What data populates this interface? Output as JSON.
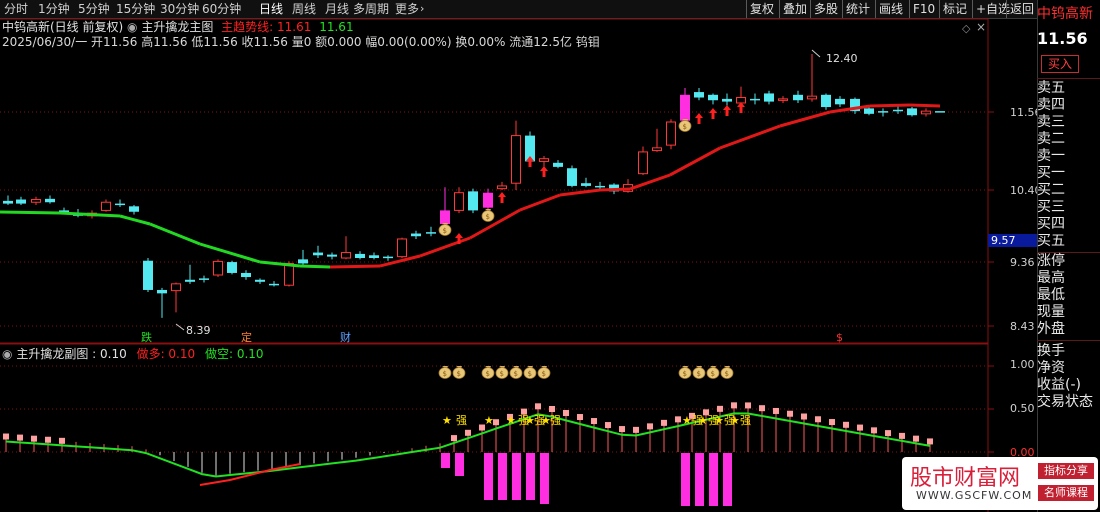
{
  "toolbar": {
    "periods": [
      "分时",
      "1分钟",
      "5分钟",
      "15分钟",
      "30分钟",
      "60分钟",
      "日线",
      "周线",
      "月线",
      "多周期",
      "更多"
    ],
    "active_period": "日线",
    "buttons": [
      "复权",
      "叠加",
      "多股",
      "统计",
      "画线",
      "F10",
      "标记",
      "+自选",
      "返回"
    ]
  },
  "header": {
    "stock_title": "中钨高新(日线 前复权)",
    "indicator_name": "主升擒龙主图",
    "line_label": "主趋势线: 11.61",
    "line_value": "11.61",
    "ohlc": "2025/06/30/一 开11.56 高11.56 低11.56 收11.56 量0 额0.000 幅0.00(0.00%) 换0.00% 流通12.5亿 钨钼"
  },
  "main_chart": {
    "price_labels": [
      "11.56",
      "10.40",
      "9.36",
      "8.43"
    ],
    "current_price_badge": "9.57",
    "high_annotation": "12.40",
    "low_annotation": "8.39",
    "markers": [
      "跌",
      "定",
      "财",
      "$"
    ],
    "trend_color_up": "#e01818",
    "trend_color_down": "#22d822",
    "candle_up_color": "#ff3838",
    "candle_down_color": "#54e8f0",
    "candle_signal_color": "#ff2ee0",
    "bag_icon": "money-bag-icon",
    "arrow_icon": "red-up-arrow-icon"
  },
  "sub_chart": {
    "name": "主升擒龙副图",
    "value": ": 0.10",
    "doduo_label": "做多: 0.10",
    "dokong_label": "做空: 0.10",
    "scale_labels": [
      "1.00",
      "0.50",
      "0.00"
    ],
    "strong_text": "强",
    "star_icon": "star-icon"
  },
  "right_panel": {
    "stock_name": "中钨高新",
    "price": "11.56",
    "buy_button": "买入",
    "levels": [
      "卖五",
      "卖四",
      "卖三",
      "卖二",
      "卖一",
      "买一",
      "买二",
      "买三",
      "买四",
      "买五"
    ],
    "stats": [
      "涨停",
      "最高",
      "最低",
      "现量",
      "外盘"
    ],
    "stats2": [
      "换手",
      "净资",
      "收益(-)",
      "交易状态"
    ]
  },
  "watermark": {
    "title": "股市财富网",
    "url": "WWW.GSCFW.COM",
    "tag1": "指标分享",
    "tag2": "名师课程"
  }
}
